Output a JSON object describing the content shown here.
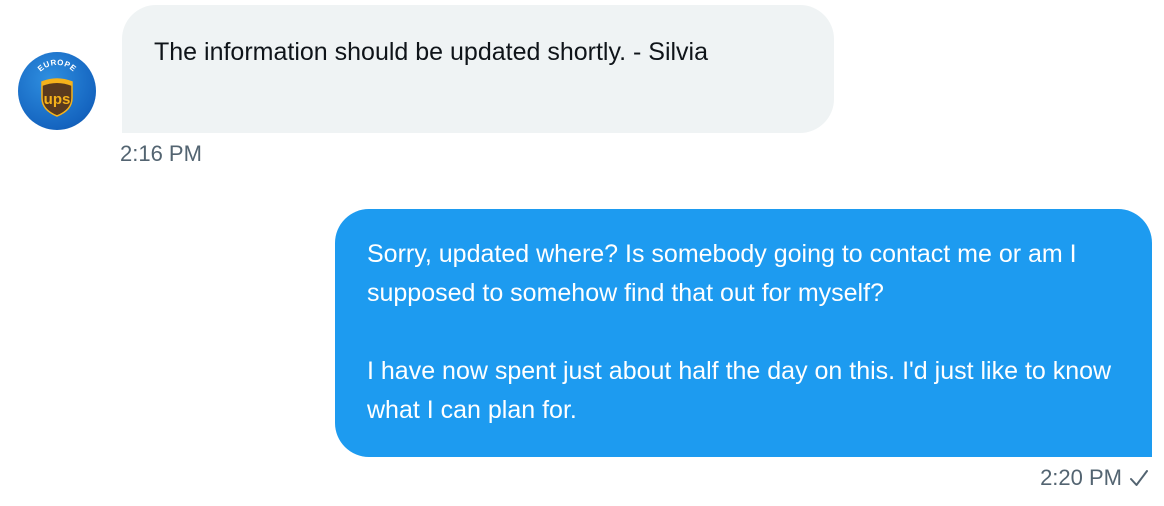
{
  "messages": {
    "incoming": {
      "sender_avatar": {
        "icon": "ups-europe-logo-icon",
        "text_top": "EUROPE",
        "text_logo": "ups"
      },
      "text": "The information should be updated shortly. - Silvia",
      "timestamp": "2:16 PM"
    },
    "outgoing": {
      "paragraphs": [
        "Sorry, updated where? Is somebody going to contact me or am I supposed to somehow find that out for myself?",
        "I have now spent just about half the day on this. I'd just like to know what I can plan for."
      ],
      "timestamp": "2:20 PM",
      "status_icon": "checkmark-icon"
    }
  },
  "colors": {
    "incoming_bubble": "#eff3f4",
    "outgoing_bubble": "#1d9bf0",
    "timestamp": "#536471",
    "text_dark": "#0f1419"
  }
}
